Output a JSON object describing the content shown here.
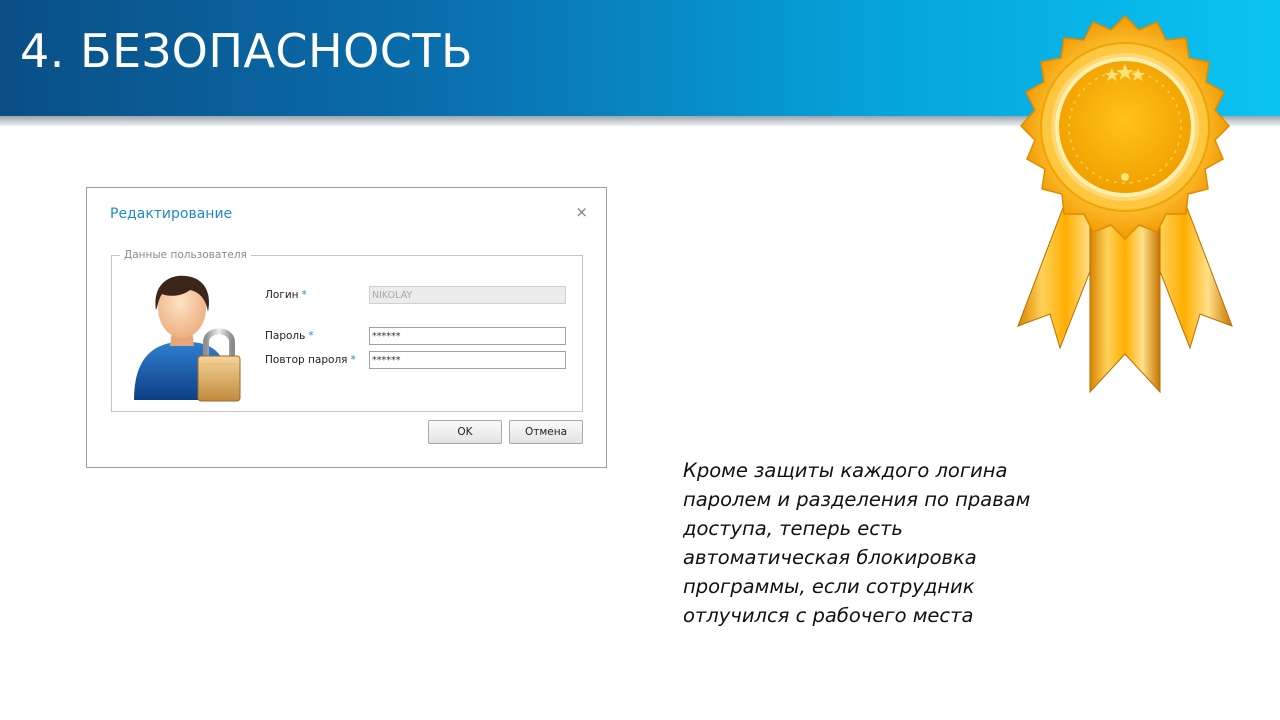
{
  "slide": {
    "title": "4. БЕЗОПАСНОСТЬ"
  },
  "dialog": {
    "title": "Редактирование",
    "close_glyph": "×",
    "group_legend": "Данные пользователя",
    "login": {
      "label": "Логин",
      "required_mark": "*",
      "value": "NIKOLAY"
    },
    "password": {
      "label": "Пароль",
      "required_mark": "*",
      "value": "******"
    },
    "password_repeat": {
      "label": "Повтор пароля",
      "required_mark": "*",
      "value": "******"
    },
    "ok_label": "OK",
    "cancel_label": "Отмена"
  },
  "caption_lines": [
    "Кроме защиты каждого логина",
    "паролем и разделения по правам",
    "доступа, теперь есть",
    "автоматическая блокировка",
    "программы, если сотрудник",
    "отлучился с рабочего места"
  ],
  "icons": {
    "avatar": "user-with-padlock-icon",
    "badge": "award-rosette-icon",
    "close": "close-icon"
  },
  "colors": {
    "banner_start": "#0a4f86",
    "banner_end": "#0bc3f2",
    "dialog_accent": "#1f8ac9",
    "rosette_gold": "#ffb000"
  }
}
